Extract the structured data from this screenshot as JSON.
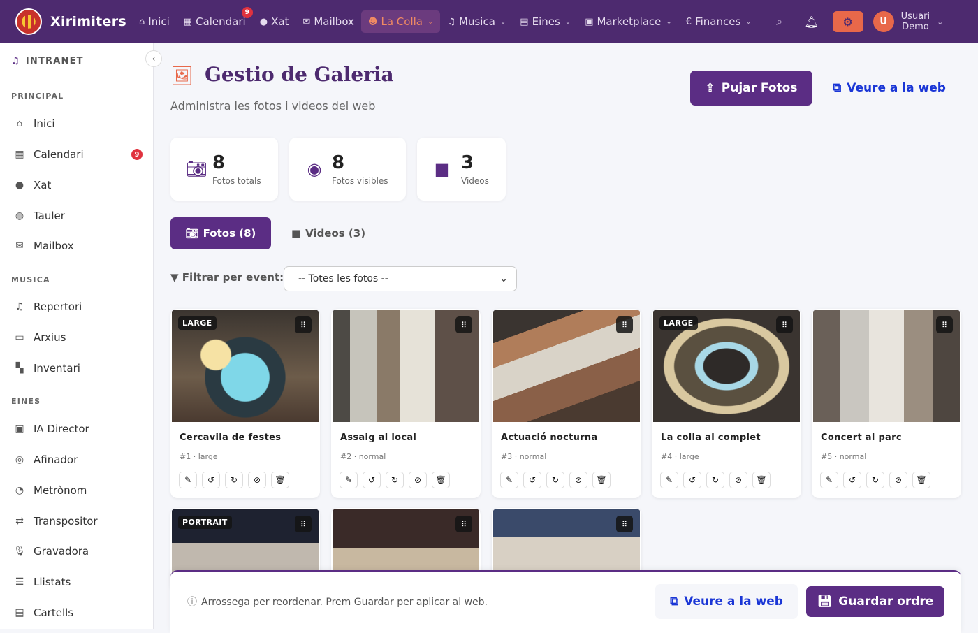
{
  "app": {
    "name": "Xirimiters"
  },
  "topnav": {
    "items": [
      {
        "label": "Inici",
        "icon": "home-icon"
      },
      {
        "label": "Calendari",
        "icon": "calendar-icon",
        "badge": "9"
      },
      {
        "label": "Xat",
        "icon": "chat-icon"
      },
      {
        "label": "Mailbox",
        "icon": "mail-icon"
      },
      {
        "label": "La Colla",
        "icon": "users-icon",
        "active": true
      },
      {
        "label": "Musica",
        "icon": "music-icon"
      },
      {
        "label": "Eines",
        "icon": "toolbox-icon"
      },
      {
        "label": "Marketplace",
        "icon": "store-icon"
      },
      {
        "label": "Finances",
        "icon": "euro-icon"
      }
    ],
    "user": {
      "initial": "U",
      "name_line1": "Usuari",
      "name_line2": "Demo"
    }
  },
  "sidebar": {
    "header": "INTRANET",
    "sections": [
      {
        "title": "PRINCIPAL",
        "items": [
          {
            "label": "Inici",
            "icon": "home-icon"
          },
          {
            "label": "Calendari",
            "icon": "calendar-icon",
            "badge": "9"
          },
          {
            "label": "Xat",
            "icon": "chat-icon"
          },
          {
            "label": "Tauler",
            "icon": "comments-icon"
          },
          {
            "label": "Mailbox",
            "icon": "mail-icon"
          }
        ]
      },
      {
        "title": "MUSICA",
        "items": [
          {
            "label": "Repertori",
            "icon": "music-icon"
          },
          {
            "label": "Arxius",
            "icon": "folder-icon"
          },
          {
            "label": "Inventari",
            "icon": "boxes-icon"
          }
        ]
      },
      {
        "title": "EINES",
        "items": [
          {
            "label": "IA Director",
            "icon": "robot-icon"
          },
          {
            "label": "Afinador",
            "icon": "target-icon"
          },
          {
            "label": "Metrònom",
            "icon": "stopwatch-icon"
          },
          {
            "label": "Transpositor",
            "icon": "exchange-icon"
          },
          {
            "label": "Gravadora",
            "icon": "microphone-icon"
          },
          {
            "label": "Llistats",
            "icon": "list-icon"
          },
          {
            "label": "Cartells",
            "icon": "poster-icon"
          }
        ]
      }
    ]
  },
  "page": {
    "title": "Gestio de Galeria",
    "subtitle": "Administra les fotos i videos del web",
    "upload_label": "Pujar Fotos",
    "view_web_label": "Veure a la web"
  },
  "stats": [
    {
      "value": "8",
      "label": "Fotos totals",
      "icon": "camera-icon"
    },
    {
      "value": "8",
      "label": "Fotos visibles",
      "icon": "eye-icon"
    },
    {
      "value": "3",
      "label": "Videos",
      "icon": "video-icon"
    }
  ],
  "tabs": [
    {
      "label": "Fotos (8)",
      "icon": "camera-icon",
      "active": true
    },
    {
      "label": "Videos (3)",
      "icon": "video-icon",
      "active": false
    }
  ],
  "filter": {
    "label": "Filtrar per event:",
    "selected": "-- Totes les fotos --"
  },
  "photos": [
    {
      "title": "Cercavila de festes",
      "meta": "#1 · large",
      "badge": "LARGE"
    },
    {
      "title": "Assaig al local",
      "meta": "#2 · normal",
      "badge": ""
    },
    {
      "title": "Actuació nocturna",
      "meta": "#3 · normal",
      "badge": ""
    },
    {
      "title": "La colla al complet",
      "meta": "#4 · large",
      "badge": "LARGE"
    },
    {
      "title": "Concert al parc",
      "meta": "#5 · normal",
      "badge": ""
    },
    {
      "badge": "PORTRAIT"
    },
    {
      "badge": ""
    },
    {
      "badge": ""
    }
  ],
  "footer": {
    "hint": "Arrossega per reordenar. Prem Guardar per aplicar al web.",
    "view_web_label": "Veure a la web",
    "save_label": "Guardar ordre"
  },
  "colors": {
    "brand": "#4d2a6f",
    "primary": "#5b2d84",
    "accent": "#e8684a",
    "link": "#1a36d6",
    "badge": "#e0323e"
  }
}
